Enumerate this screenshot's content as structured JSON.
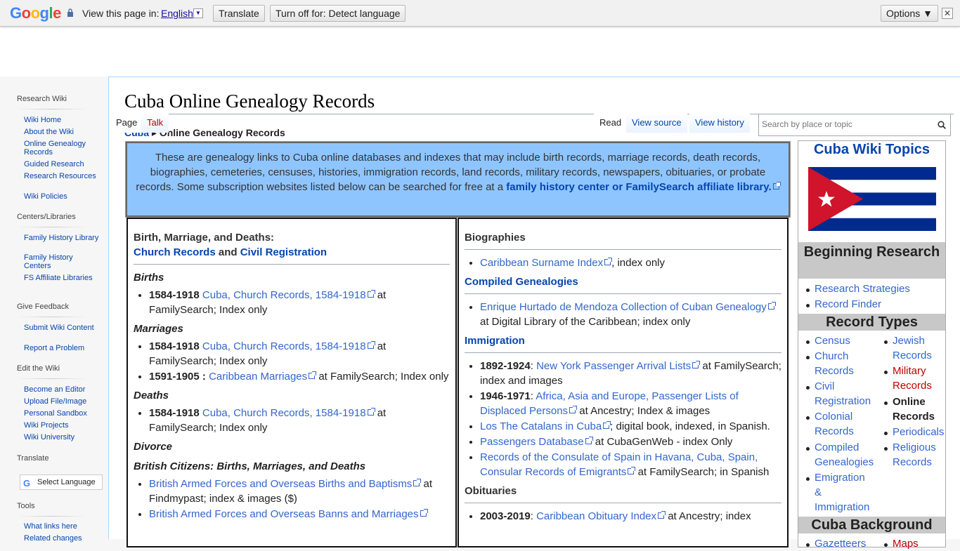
{
  "translate_bar": {
    "logo": "Google",
    "view_label": "View this page in:",
    "language": "English",
    "translate_btn": "Translate",
    "turn_off_btn": "Turn off for: Detect language",
    "options_btn": "Options ▼",
    "close": "✕"
  },
  "sidebar": {
    "sections": [
      {
        "heading": "Research Wiki",
        "items": [
          "Wiki Home",
          "About the Wiki",
          "Online Genealogy Records",
          "Guided Research",
          "Research Resources",
          "Wiki Policies"
        ]
      },
      {
        "heading": "Centers/Libraries",
        "items": [
          "Family History Library",
          "Family History Centers",
          "FS Affiliate Libraries"
        ]
      },
      {
        "heading": "Give Feedback",
        "items": [
          "Submit Wiki Content",
          "Report a Problem"
        ]
      },
      {
        "heading": "Edit the Wiki",
        "items": [
          "Become an Editor",
          "Upload File/Image",
          "Personal Sandbox",
          "Wiki Projects",
          "Wiki University"
        ]
      },
      {
        "heading": "Translate",
        "items": []
      },
      {
        "heading": "Tools",
        "items": [
          "What links here",
          "Related changes"
        ]
      }
    ],
    "select_language": "Select Language"
  },
  "page": {
    "title": "Cuba Online Genealogy Records",
    "tabs": {
      "page": "Page",
      "talk": "Talk",
      "read": "Read",
      "view_source": "View source",
      "view_history": "View history"
    },
    "search_placeholder": "Search by place or topic",
    "breadcrumb_link": "Cuba",
    "breadcrumb_sep": "▸",
    "breadcrumb_current": "Online Genealogy Records"
  },
  "intro": {
    "text": "These are genealogy links to Cuba online databases and indexes that may include birth records, marriage records, death records, biographies, cemeteries, censuses, histories, immigration records, land records, military records, newspapers, obituaries, or probate records. Some subscription websites listed below can be searched for free at a ",
    "link": "family history center or FamilySearch affiliate library."
  },
  "left_col": {
    "heading": "Birth, Marriage, and Deaths:",
    "link_church": "Church Records",
    "and": "and",
    "link_civil": "Civil Registration",
    "births": "Births",
    "marriages": "Marriages",
    "deaths": "Deaths",
    "divorce": "Divorce",
    "british": "British Citizens: Births, Marriages, and Deaths",
    "year_1584": "1584-1918",
    "church_records_link": "Cuba, Church Records, 1584-1918",
    "at_fs_index": "at FamilySearch; Index only",
    "year_1591": "1591-1905 :",
    "caribbean_marriages": "Caribbean Marriages",
    "caribbean_marriages_suffix": "at FamilySearch; Index only",
    "british_births": "British Armed Forces and Overseas Births and Baptisms",
    "british_births_suffix": "at Findmypast; index & images ($)",
    "british_banns": "British Armed Forces and Overseas Banns and Marriages"
  },
  "mid_col": {
    "biographies": "Biographies",
    "surname_index": "Caribbean Surname Index",
    "surname_suffix": ", index only",
    "compiled": "Compiled Genealogies",
    "mendoza": "Enrique Hurtado de Mendoza Collection of Cuban Genealogy",
    "mendoza_suffix": "at Digital Library of the Caribbean; index only",
    "immigration": "Immigration",
    "y1892": "1892-1924",
    "ny_passenger": "New York Passenger Arrival Lists",
    "ny_suffix": "at FamilySearch; index and images",
    "y1946": "1946-1971",
    "displaced": "Africa, Asia and Europe, Passenger Lists of Displaced Persons",
    "displaced_suffix": "at Ancestry; Index & images",
    "catalans": "Los The Catalans in Cuba",
    "catalans_suffix": "; digital book, indexed, in Spanish.",
    "passengers_db": "Passengers Database",
    "passengers_suffix": "at CubaGenWeb - index Only",
    "consulate": "Records of the Consulate of Spain in Havana, Cuba, Spain, Consular Records of Emigrants",
    "consulate_suffix": "at FamilySearch; in Spanish",
    "obituaries": "Obituaries",
    "y2003": "2003-2019",
    "obit_index": "Caribbean Obituary Index",
    "obit_suffix": "at Ancestry; index"
  },
  "right_box": {
    "title": "Cuba Wiki Topics",
    "beginning": "Beginning Research",
    "beg_items": [
      "Research Strategies",
      "Record Finder"
    ],
    "record_types": "Record Types",
    "rt_left": [
      "Census",
      "Church Records",
      "Civil Registration",
      "Colonial Records",
      "Compiled Genealogies",
      "Emigration & Immigration"
    ],
    "rt_right": [
      "Jewish Records",
      "Military Records",
      "Online Records",
      "Periodicals",
      "Religious Records"
    ],
    "background": "Cuba Background",
    "bg_left": "Gazetteers",
    "bg_right": "Maps",
    "colors": {
      "flag_blue": "#002a8f",
      "flag_red": "#cf142b"
    }
  }
}
